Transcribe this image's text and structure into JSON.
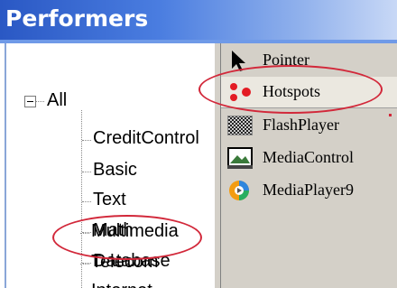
{
  "panel": {
    "title": "Performers"
  },
  "tree": {
    "root_label": "All",
    "items": [
      "CreditControl",
      "Basic",
      "Text",
      "Math",
      "Database",
      "Multimedia",
      "Telecom",
      "Internet"
    ]
  },
  "list": {
    "items": [
      {
        "label": "Pointer",
        "icon": "pointer-arrow-icon"
      },
      {
        "label": "Hotspots",
        "icon": "hotspots-icon"
      },
      {
        "label": "FlashPlayer",
        "icon": "flashplayer-icon"
      },
      {
        "label": "MediaControl",
        "icon": "mediacontrol-icon"
      },
      {
        "label": "MediaPlayer9",
        "icon": "mediaplayer9-icon"
      }
    ]
  },
  "colors": {
    "header_blue": "#2a58c4",
    "highlight_red": "#d2283a",
    "panel_gray": "#d4d0c8"
  }
}
